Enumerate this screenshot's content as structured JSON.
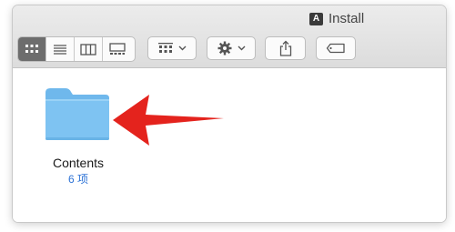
{
  "window": {
    "title": "Install",
    "title_icon": "adobe-logo-icon",
    "title_icon_text": "A"
  },
  "toolbar": {
    "view_modes": [
      {
        "name": "icon-view",
        "icon": "grid-icon",
        "active": true
      },
      {
        "name": "list-view",
        "icon": "list-icon",
        "active": false
      },
      {
        "name": "column-view",
        "icon": "columns-icon",
        "active": false
      },
      {
        "name": "gallery-view",
        "icon": "gallery-icon",
        "active": false
      }
    ],
    "group_button_icon": "grid-icon",
    "action_button_icon": "gear-icon",
    "share_button_icon": "share-icon",
    "tags_button_icon": "tag-icon"
  },
  "content": {
    "folder": {
      "name": "Contents",
      "count": "6 项",
      "icon": "folder-icon"
    },
    "annotation_icon": "red-arrow-icon"
  },
  "colors": {
    "folder": "#7ec3f2",
    "folder_tab": "#6fb8ec",
    "count_text": "#2e73d6",
    "arrow": "#e4231d",
    "active_segment": "#6d6d6d"
  }
}
